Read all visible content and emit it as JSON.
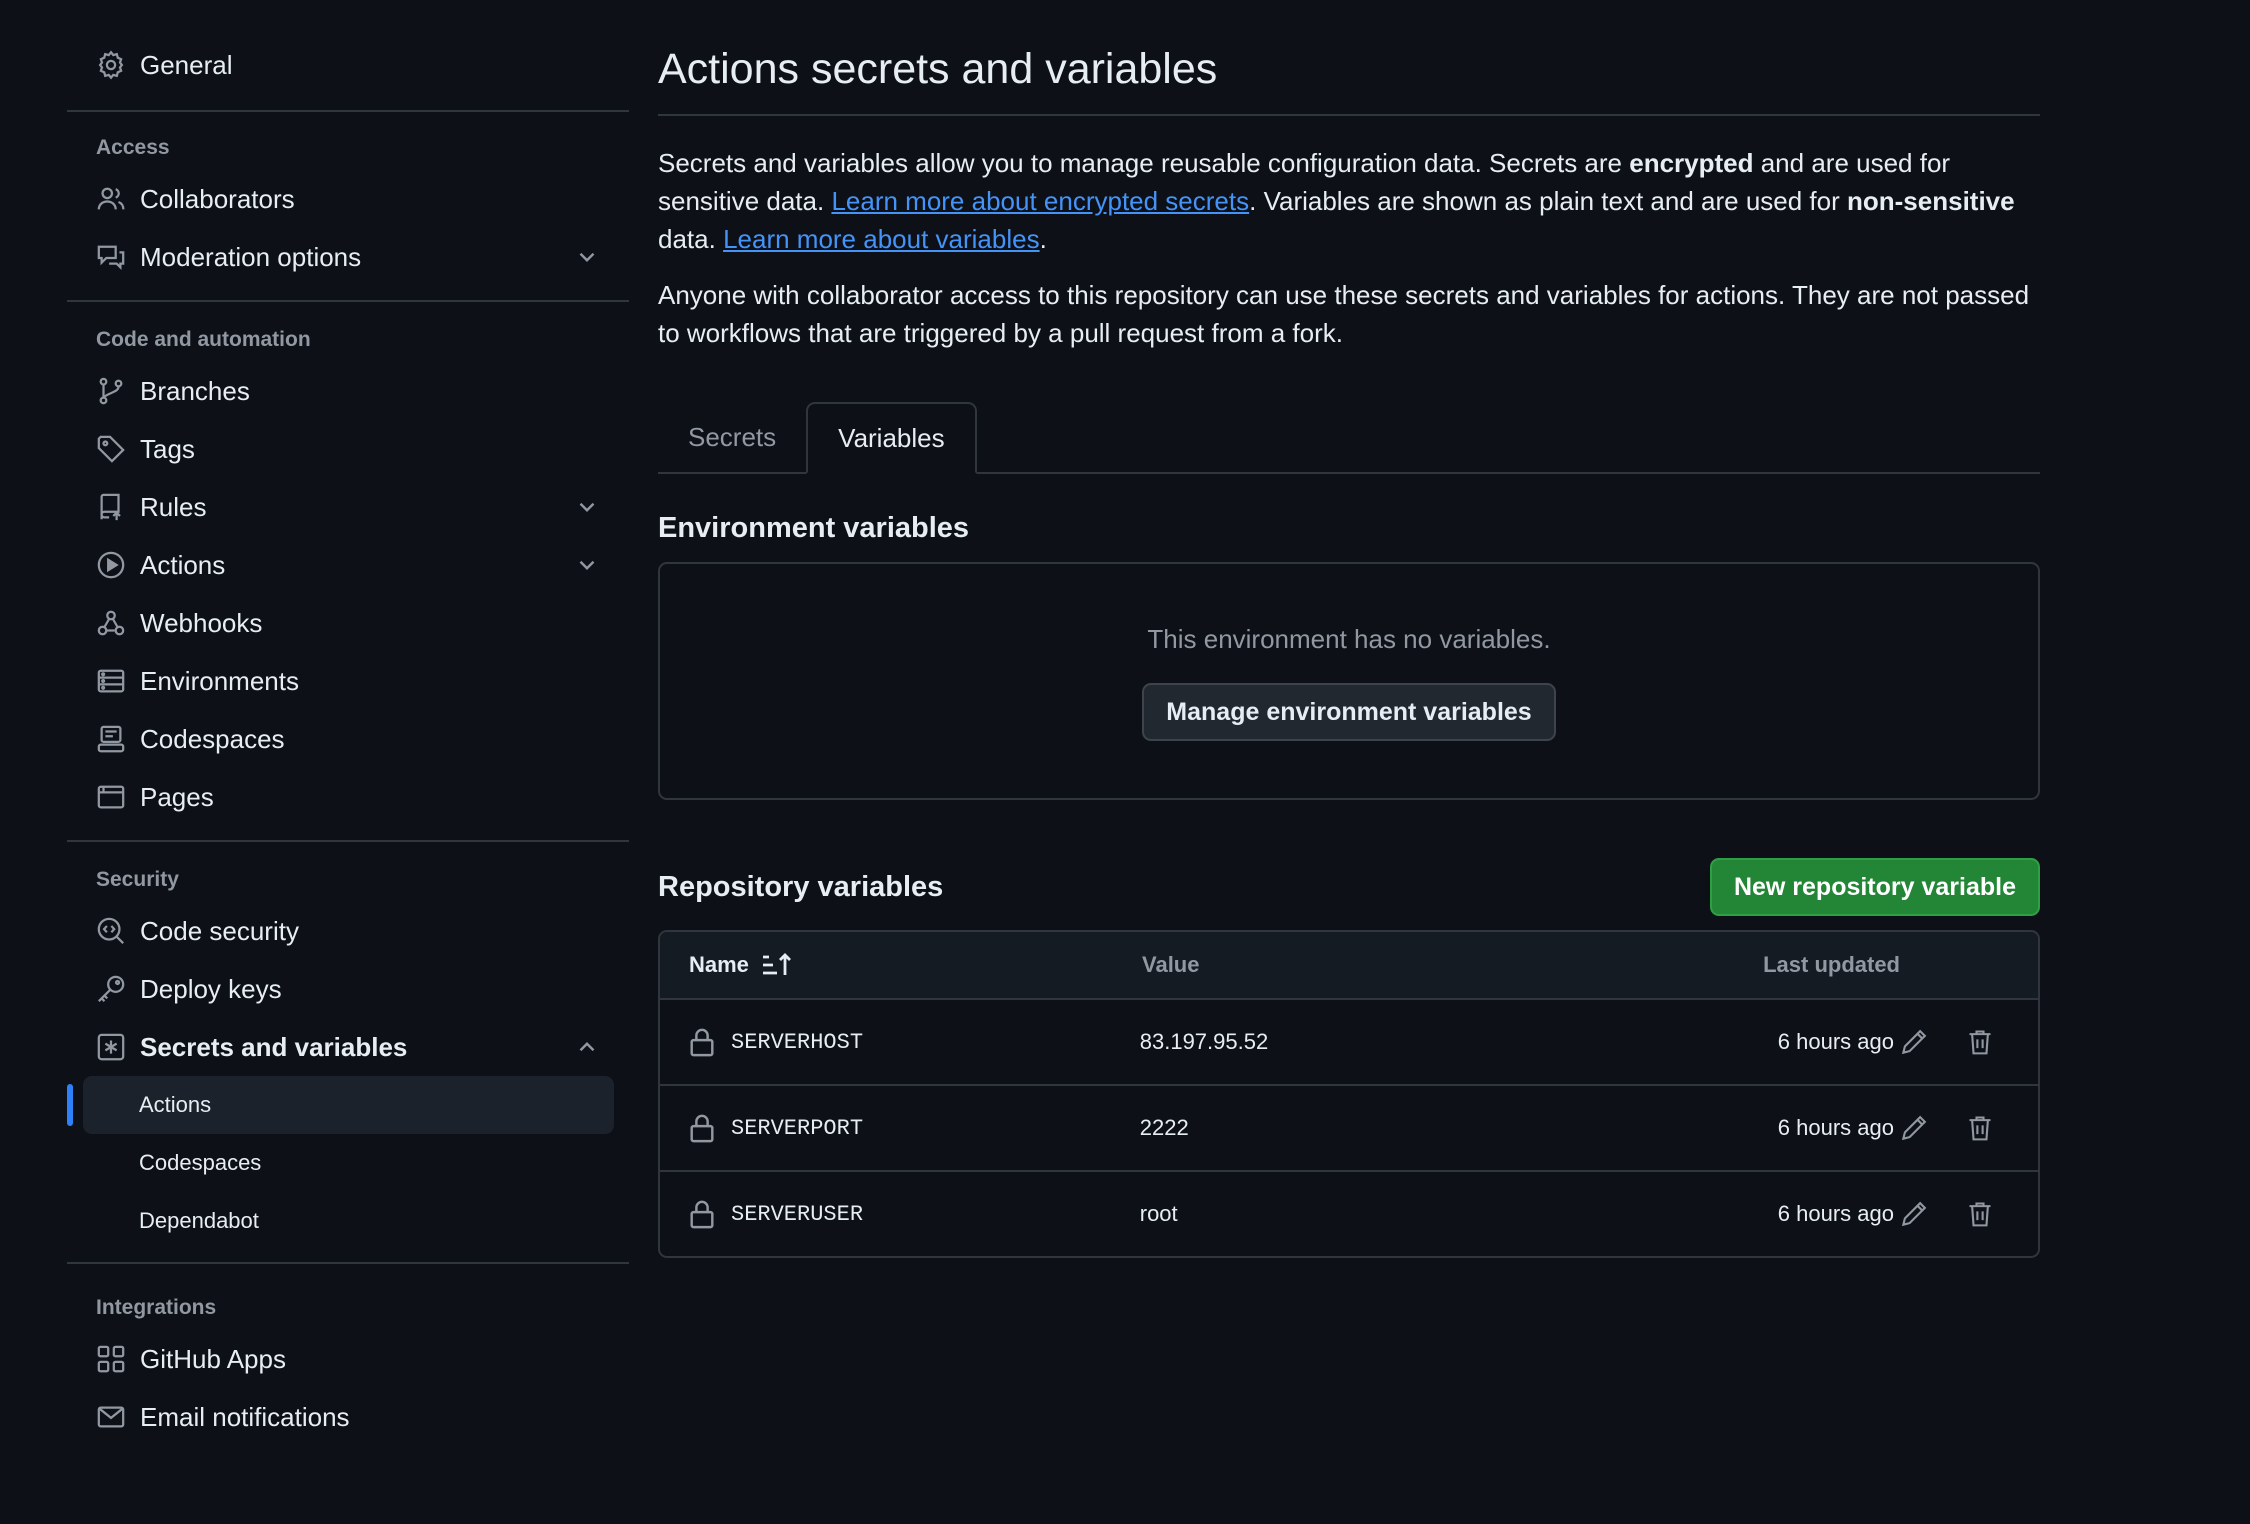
{
  "sidebar": {
    "general": "General",
    "access": {
      "title": "Access",
      "collaborators": "Collaborators",
      "moderation": "Moderation options"
    },
    "code": {
      "title": "Code and automation",
      "branches": "Branches",
      "tags": "Tags",
      "rules": "Rules",
      "actions": "Actions",
      "webhooks": "Webhooks",
      "environments": "Environments",
      "codespaces": "Codespaces",
      "pages": "Pages"
    },
    "security": {
      "title": "Security",
      "code_security": "Code security",
      "deploy_keys": "Deploy keys",
      "secrets": "Secrets and variables",
      "sub": {
        "actions": "Actions",
        "codespaces": "Codespaces",
        "dependabot": "Dependabot"
      }
    },
    "integrations": {
      "title": "Integrations",
      "github_apps": "GitHub Apps",
      "email": "Email notifications"
    }
  },
  "main": {
    "title": "Actions secrets and variables",
    "p1": {
      "t1": "Secrets and variables allow you to manage reusable configuration data. Secrets are ",
      "b1": "encrypted",
      "t2": " and are used for sensitive data. ",
      "link1": "Learn more about encrypted secrets",
      "t3": ". Variables are shown as plain text and are used for ",
      "b2": "non-sensitive",
      "t4": " data. ",
      "link2": "Learn more about variables",
      "t5": "."
    },
    "p2": "Anyone with collaborator access to this repository can use these secrets and variables for actions. They are not passed to workflows that are triggered by a pull request from a fork.",
    "tabs": {
      "secrets": "Secrets",
      "variables": "Variables"
    },
    "env": {
      "title": "Environment variables",
      "empty": "This environment has no variables.",
      "button": "Manage environment variables"
    },
    "repo": {
      "title": "Repository variables",
      "new_button": "New repository variable",
      "headers": {
        "name": "Name",
        "value": "Value",
        "updated": "Last updated"
      },
      "rows": [
        {
          "name": "SERVERHOST",
          "value": "83.197.95.52",
          "updated": "6 hours ago"
        },
        {
          "name": "SERVERPORT",
          "value": "2222",
          "updated": "6 hours ago"
        },
        {
          "name": "SERVERUSER",
          "value": "root",
          "updated": "6 hours ago"
        }
      ]
    }
  },
  "colors": {
    "background": "#0d1117",
    "link": "#4493f8",
    "primary_button": "#238636",
    "active_indicator": "#2f81f7"
  }
}
